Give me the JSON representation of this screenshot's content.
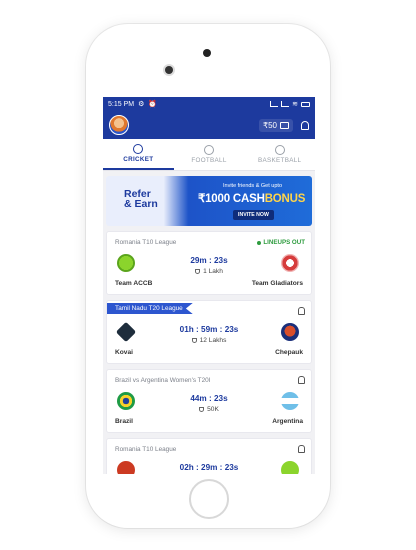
{
  "status_bar": {
    "time": "5:15 PM",
    "battery_label": ""
  },
  "header": {
    "wallet_amount": "₹50"
  },
  "tabs": [
    {
      "label": "CRICKET"
    },
    {
      "label": "FOOTBALL"
    },
    {
      "label": "BASKETBALL"
    }
  ],
  "banner": {
    "refer_line1": "Refer",
    "refer_line2": "& Earn",
    "invite_text": "Invite friends & Get upto",
    "bonus_amount": "₹1000 CASH",
    "bonus_word": "BONUS",
    "button_label": "INVITE NOW"
  },
  "matches": [
    {
      "league": "Romania T10 League",
      "status": "LINEUPS OUT",
      "team1": "Team ACCB",
      "team2": "Team Gladiators",
      "time": "29m : 23s",
      "prize": "1 Lakh"
    },
    {
      "league": "Tamil Nadu T20 League",
      "team1": "Kovai",
      "team2": "Chepauk",
      "time": "01h : 59m : 23s",
      "prize": "12 Lakhs"
    },
    {
      "league": "Brazil vs Argentina Women's T20I",
      "team1": "Brazil",
      "team2": "Argentina",
      "time": "44m : 23s",
      "prize": "50K"
    },
    {
      "league": "Romania T10 League",
      "team1": "",
      "team2": "",
      "time": "02h : 29m : 23s",
      "prize": ""
    }
  ]
}
